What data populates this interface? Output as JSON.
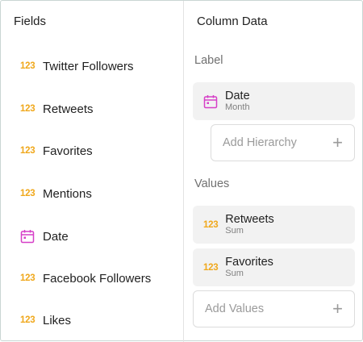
{
  "fields_panel": {
    "title": "Fields",
    "items": [
      {
        "icon": "number-icon",
        "icon_text": "123",
        "label": "Twitter Followers"
      },
      {
        "icon": "number-icon",
        "icon_text": "123",
        "label": "Retweets"
      },
      {
        "icon": "number-icon",
        "icon_text": "123",
        "label": "Favorites"
      },
      {
        "icon": "number-icon",
        "icon_text": "123",
        "label": "Mentions"
      },
      {
        "icon": "calendar-icon",
        "icon_text": "",
        "label": "Date"
      },
      {
        "icon": "number-icon",
        "icon_text": "123",
        "label": "Facebook Followers"
      },
      {
        "icon": "number-icon",
        "icon_text": "123",
        "label": "Likes"
      }
    ]
  },
  "column_panel": {
    "title": "Column Data",
    "label_section": {
      "heading": "Label",
      "chip": {
        "icon": "calendar-icon",
        "main": "Date",
        "sub": "Month"
      },
      "add_placeholder": "Add Hierarchy"
    },
    "values_section": {
      "heading": "Values",
      "chips": [
        {
          "icon": "number-icon",
          "icon_text": "123",
          "main": "Retweets",
          "sub": "Sum"
        },
        {
          "icon": "number-icon",
          "icon_text": "123",
          "main": "Favorites",
          "sub": "Sum"
        }
      ],
      "add_placeholder": "Add Values"
    }
  },
  "colors": {
    "number_icon": "#f0a81c",
    "calendar_icon": "#d63fc7",
    "chip_bg": "#f2f2f2"
  }
}
